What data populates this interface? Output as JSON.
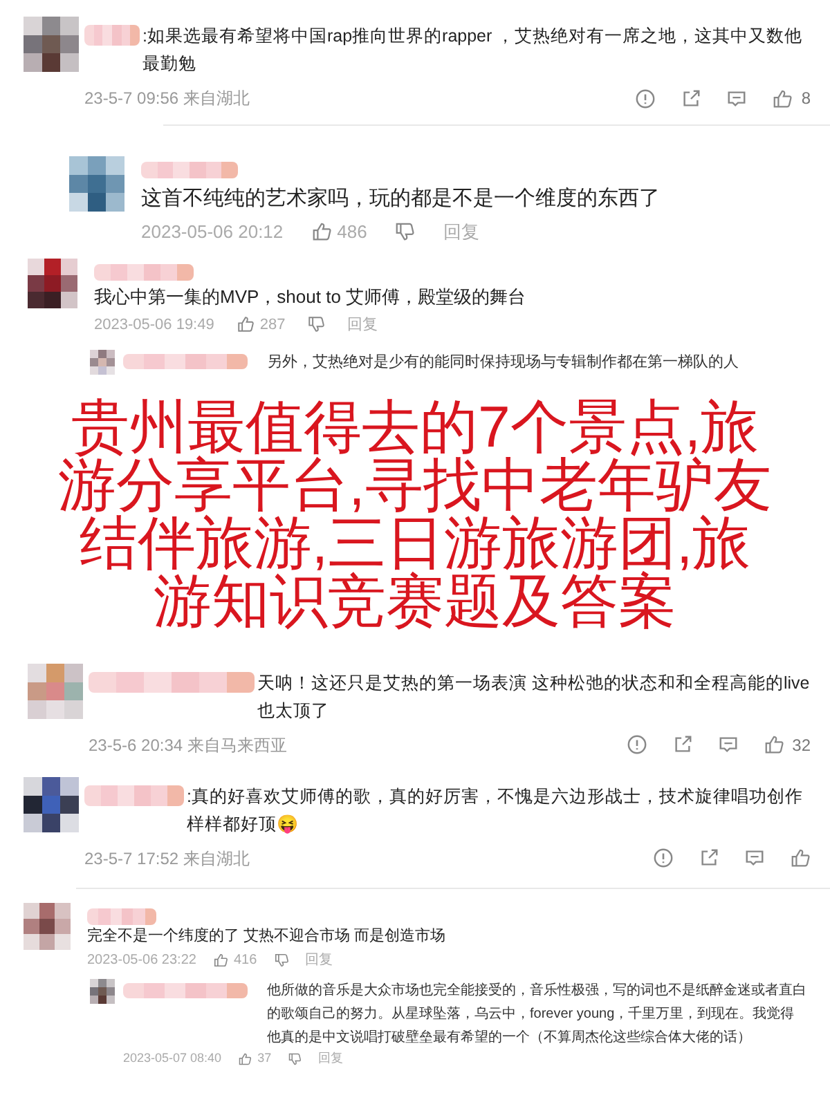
{
  "comments": [
    {
      "kind": "weibo",
      "text": ":如果选最有希望将中国rap推向世界的rapper ，艾热绝对有一席之地，这其中又数他最勤勉",
      "meta": "23-5-7 09:56 来自湖北",
      "likes": "8",
      "divider": true
    },
    {
      "kind": "thread",
      "text": "这首不纯纯的艺术家吗，玩的都是不是一个维度的东西了",
      "meta": "2023-05-06 20:12",
      "likes": "486",
      "reply_label": "回复"
    },
    {
      "kind": "thread",
      "text": "我心中第一集的MVP，shout to 艾师傅，殿堂级的舞台",
      "meta": "2023-05-06 19:49",
      "likes": "287",
      "reply_label": "回复",
      "replies": [
        {
          "text": "另外，艾热绝对是少有的能同时保持现场与专辑制作都在第一梯队的人"
        }
      ]
    },
    {
      "kind": "banner",
      "lines": [
        "贵州最值得去的7个景点,旅",
        "游分享平台,寻找中老年驴友",
        "结伴旅游,三日游旅游团,旅",
        "游知识竞赛题及答案"
      ]
    },
    {
      "kind": "weibo",
      "text": "天呐！这还只是艾热的第一场表演 这种松弛的状态和和全程高能的live也太顶了",
      "meta": "23-5-6 20:34 来自马来西亚",
      "likes": "32",
      "divider": false
    },
    {
      "kind": "weibo",
      "text": ":真的好喜欢艾师傅的歌，真的好厉害，不愧是六边形战士，技术旋律唱功创作样样都好顶😝",
      "meta": "23-5-7 17:52 来自湖北",
      "divider": true
    },
    {
      "kind": "thread",
      "text": "完全不是一个纬度的了 艾热不迎合市场 而是创造市场",
      "meta": "2023-05-06 23:22",
      "likes": "416",
      "reply_label": "回复",
      "replies": [
        {
          "text": "他所做的音乐是大众市场也完全能接受的，音乐性极强，写的词也不是纸醉金迷或者直白的歌颂自己的努力。从星球坠落，乌云中，forever young，千里万里，到现在。我觉得他真的是中文说唱打破壁垒最有希望的一个（不算周杰伦这些综合体大佬的话）",
          "meta": "2023-05-07 08:40",
          "likes": "37",
          "reply_label": "回复"
        }
      ]
    }
  ]
}
